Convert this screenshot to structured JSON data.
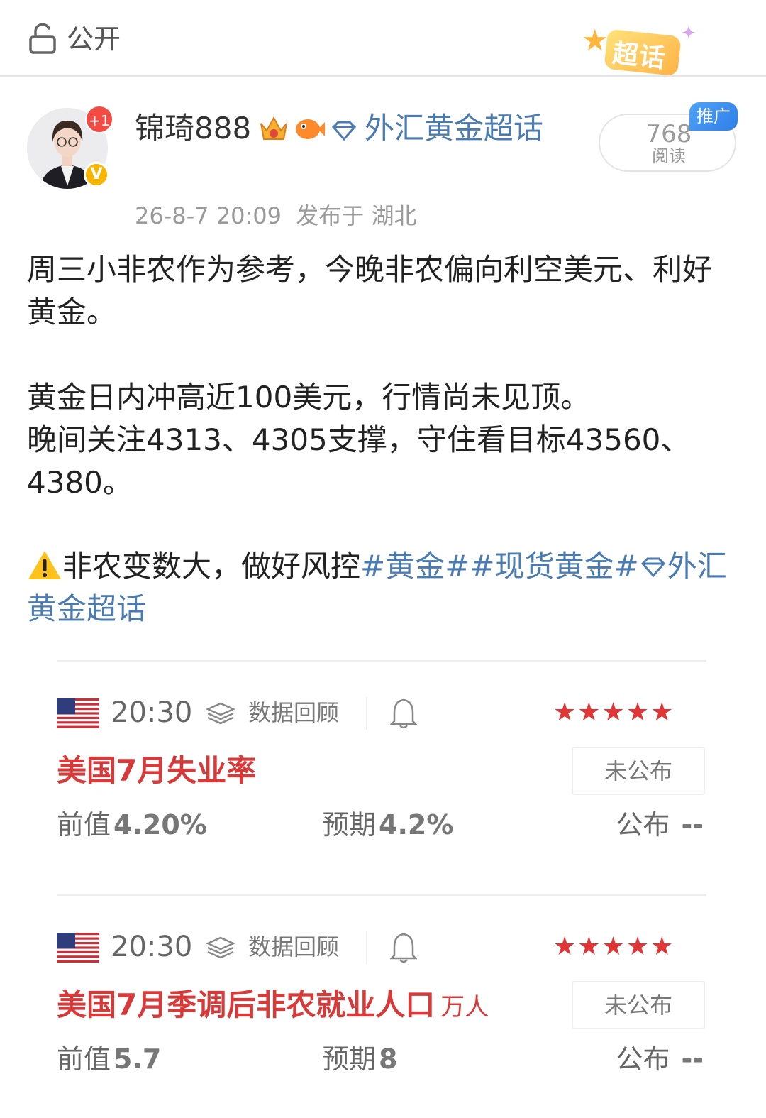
{
  "header": {
    "visibility_label": "公开",
    "supertopic_badge": "超话"
  },
  "author": {
    "name": "锦琦888",
    "notification_badge": "+1",
    "verified_badge": "V",
    "topic_link": "外汇黄金超话",
    "posted_time": "26-8-7 20:09",
    "location": "发布于 湖北"
  },
  "stats": {
    "read_count": "768",
    "read_label": "阅读",
    "promo_tag": "推广"
  },
  "post": {
    "para1": "周三小非农作为参考，今晚非农偏向利空美元、利好黄金。",
    "para2_line1": "黄金日内冲高近100美元，行情尚未见顶。",
    "para2_line2": "晚间关注4313、4305支撑，守住看目标43560、4380。",
    "warning_text": "非农变数大，做好风控",
    "hashtag1": "#黄金#",
    "hashtag2": "#现货黄金#",
    "hashtag3": "外汇黄金超话"
  },
  "calendar": [
    {
      "time": "20:30",
      "review_label": "数据回顾",
      "importance_stars": "★★★★★",
      "title": "美国7月失业率",
      "unit": "",
      "status": "未公布",
      "previous_label": "前值",
      "previous_value": "4.20%",
      "forecast_label": "预期",
      "forecast_value": "4.2%",
      "actual_label": "公布",
      "actual_value": "--"
    },
    {
      "time": "20:30",
      "review_label": "数据回顾",
      "importance_stars": "★★★★★",
      "title": "美国7月季调后非农就业人口",
      "unit": "万人",
      "status": "未公布",
      "previous_label": "前值",
      "previous_value": "5.7",
      "forecast_label": "预期",
      "forecast_value": "8",
      "actual_label": "公布",
      "actual_value": "--"
    }
  ],
  "colors": {
    "link_blue": "#4a7bb3",
    "event_red": "#d83a3a",
    "star_red": "#e23636"
  }
}
